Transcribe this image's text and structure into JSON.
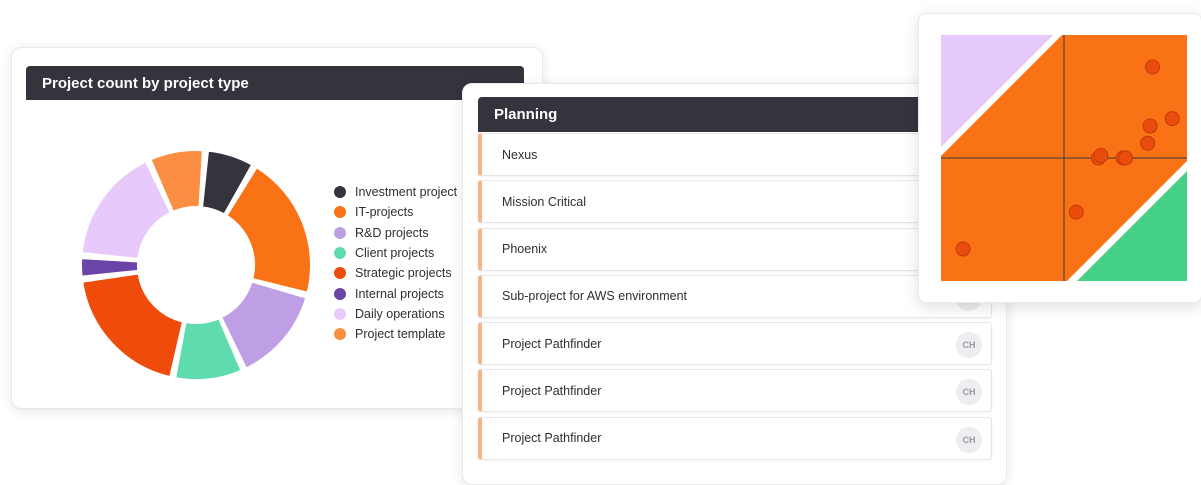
{
  "chart_card": {
    "title": "Project count by project type"
  },
  "chart_data": {
    "type": "pie",
    "title": "Project count by project type",
    "categories": [
      "Investment projects",
      "IT-projects",
      "R&D projects",
      "Client projects",
      "Strategic projects",
      "Internal projects",
      "Daily operations",
      "Project template"
    ],
    "values": [
      7,
      21,
      14,
      10,
      20,
      3,
      17,
      8
    ],
    "colors": [
      "#35343c",
      "#f97316",
      "#be9fe6",
      "#5fdcae",
      "#ef4c0b",
      "#6b44a8",
      "#e7c9fb",
      "#fb8e43"
    ],
    "legend_position": "right",
    "legend_labels": [
      "Investment project",
      "IT-projects",
      "R&D projects",
      "Client projects",
      "Strategic projects",
      "Internal projects",
      "Daily operations",
      "Project template"
    ]
  },
  "planning": {
    "title": "Planning",
    "rows": [
      {
        "name": "Nexus",
        "avatar": ""
      },
      {
        "name": "Mission Critical",
        "avatar": ""
      },
      {
        "name": "Phoenix",
        "avatar": ""
      },
      {
        "name": "Sub-project for AWS environment",
        "avatar": ""
      },
      {
        "name": "Project Pathfinder",
        "avatar": "CH"
      },
      {
        "name": "Project Pathfinder",
        "avatar": "CH"
      },
      {
        "name": "Project Pathfinder",
        "avatar": "CH"
      }
    ]
  },
  "matrix": {
    "colors": {
      "orange": "#f97316",
      "purple": "#e6c9fb",
      "green": "#44d086",
      "dot": "#ea4c0e",
      "dot_stroke": "#c43a06"
    },
    "points": [
      {
        "x": 0.09,
        "y": 0.13
      },
      {
        "x": 0.55,
        "y": 0.28
      },
      {
        "x": 0.64,
        "y": 0.5
      },
      {
        "x": 0.65,
        "y": 0.51
      },
      {
        "x": 0.74,
        "y": 0.5
      },
      {
        "x": 0.75,
        "y": 0.5
      },
      {
        "x": 0.84,
        "y": 0.56
      },
      {
        "x": 0.85,
        "y": 0.63
      },
      {
        "x": 0.86,
        "y": 0.87
      },
      {
        "x": 0.94,
        "y": 0.66
      }
    ]
  }
}
